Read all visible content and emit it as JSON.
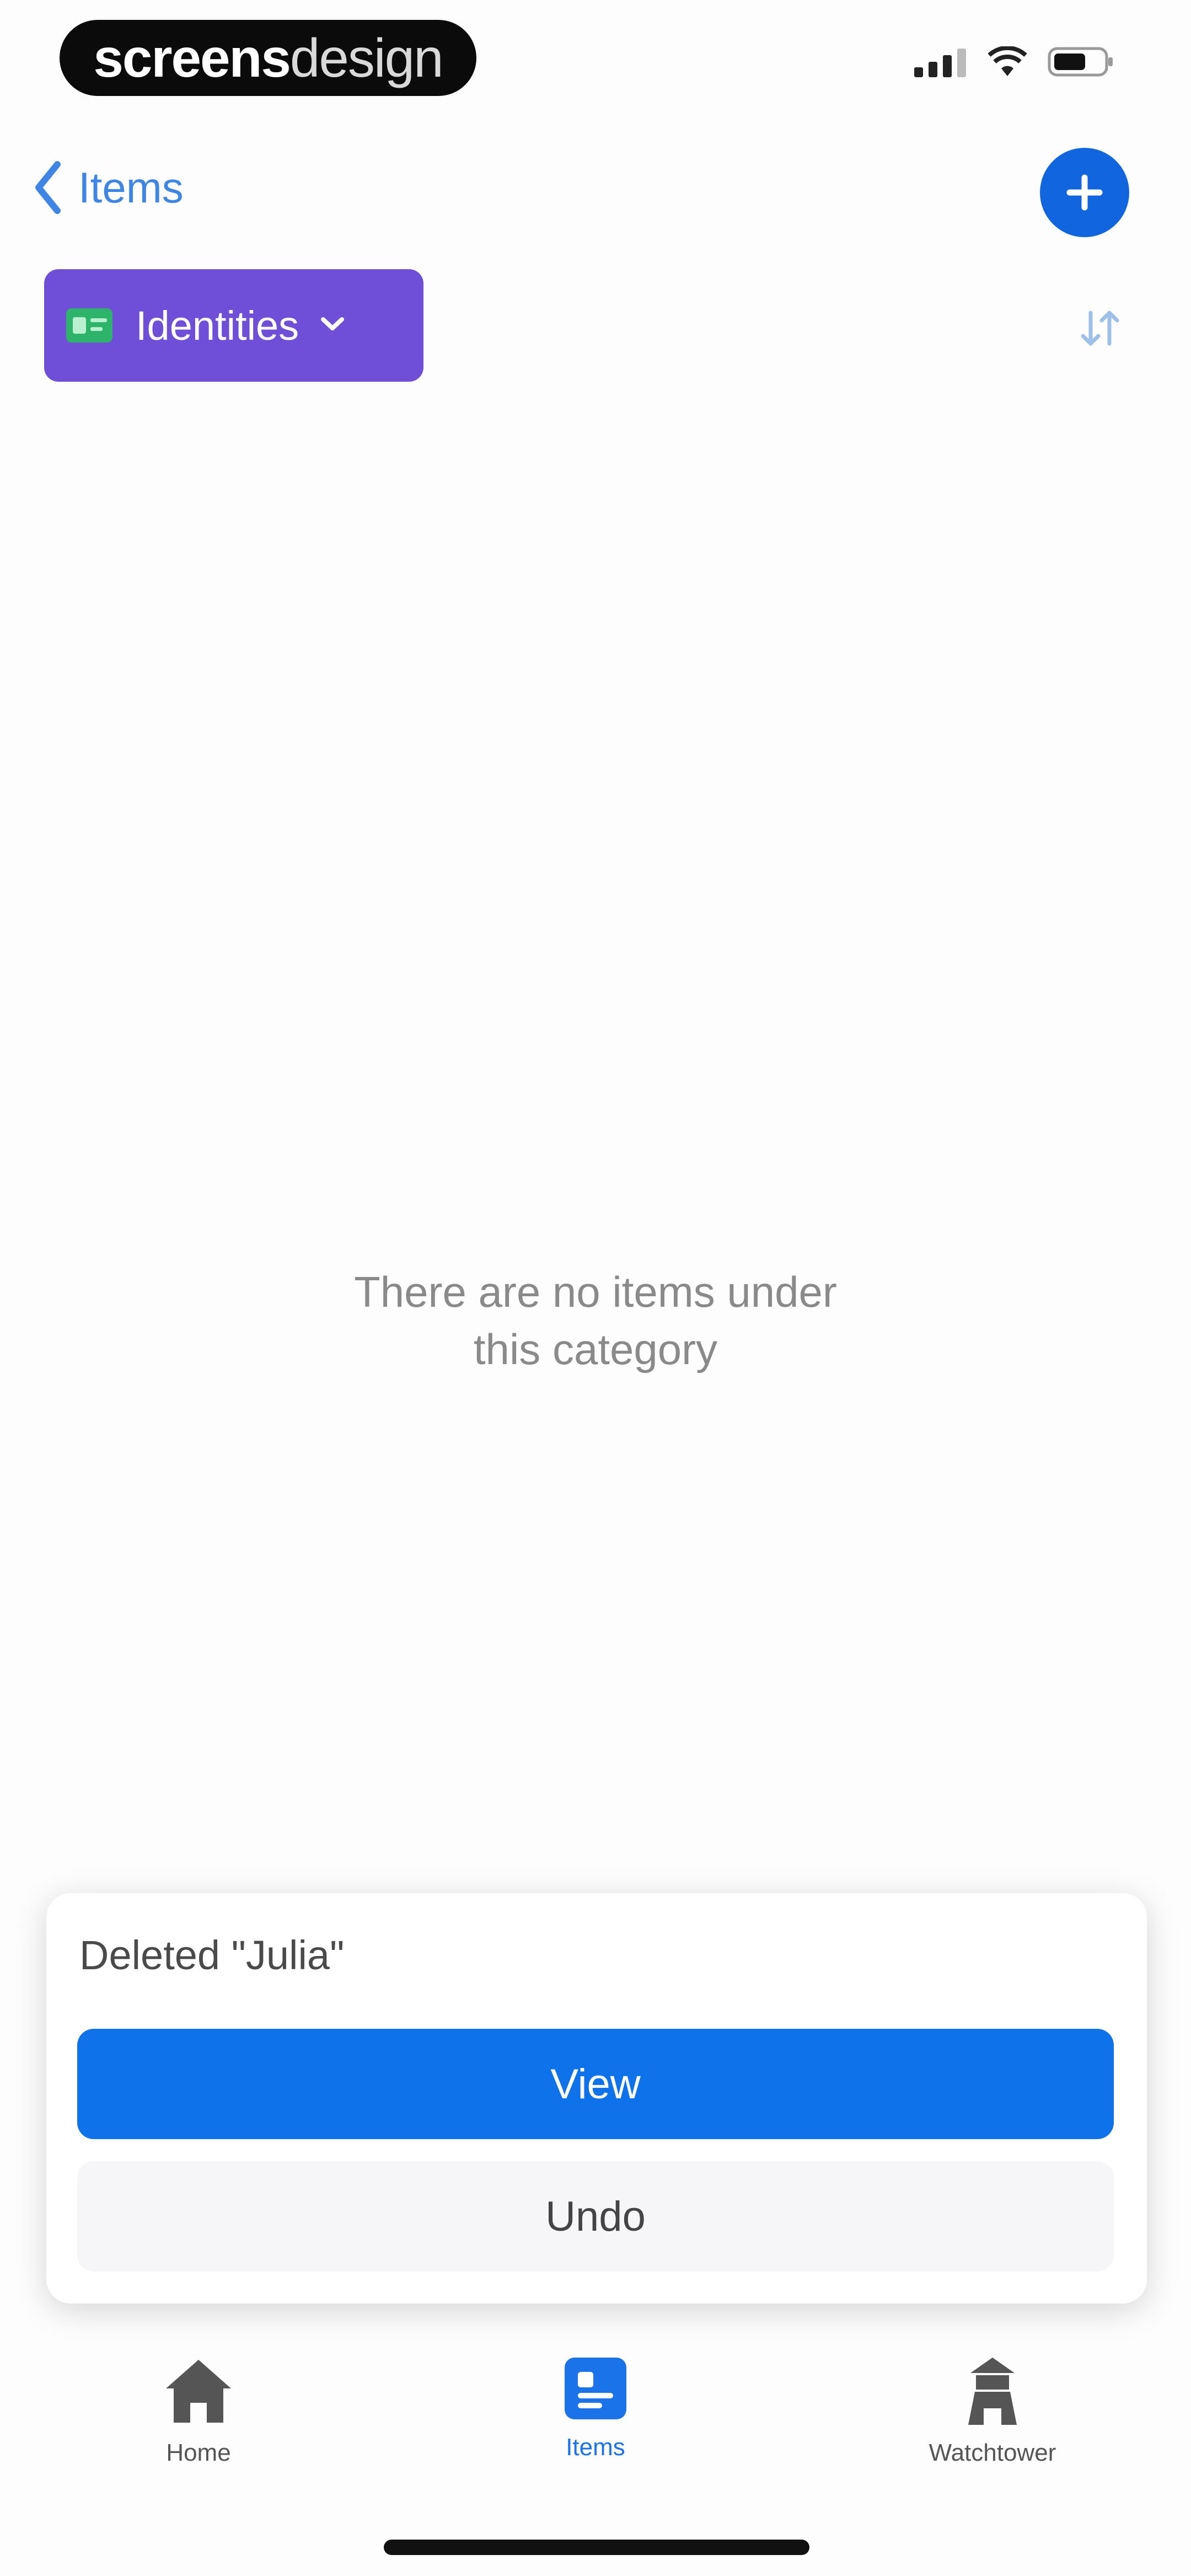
{
  "status_bar": {
    "brand_bold": "screens",
    "brand_light": "design"
  },
  "nav": {
    "back_label": "Items",
    "back_icon": "chevron-left-icon",
    "add_icon": "plus-icon"
  },
  "category": {
    "label": "Identities",
    "icon": "id-card-icon",
    "dropdown_icon": "chevron-down-icon",
    "sort_icon": "sort-icon"
  },
  "empty_state": {
    "line1": "There are no items under",
    "line2": "this category"
  },
  "toast": {
    "message": "Deleted \"Julia\"",
    "view_label": "View",
    "undo_label": "Undo"
  },
  "tab_bar": {
    "tabs": [
      {
        "label": "Home",
        "icon": "home-icon",
        "active": false
      },
      {
        "label": "Items",
        "icon": "items-icon",
        "active": true
      },
      {
        "label": "Watchtower",
        "icon": "watchtower-icon",
        "active": false
      }
    ]
  },
  "colors": {
    "accent": "#1166e0",
    "category_bg": "#6f4fd8",
    "inactive_tab": "#555555",
    "active_tab": "#1a73e8"
  }
}
